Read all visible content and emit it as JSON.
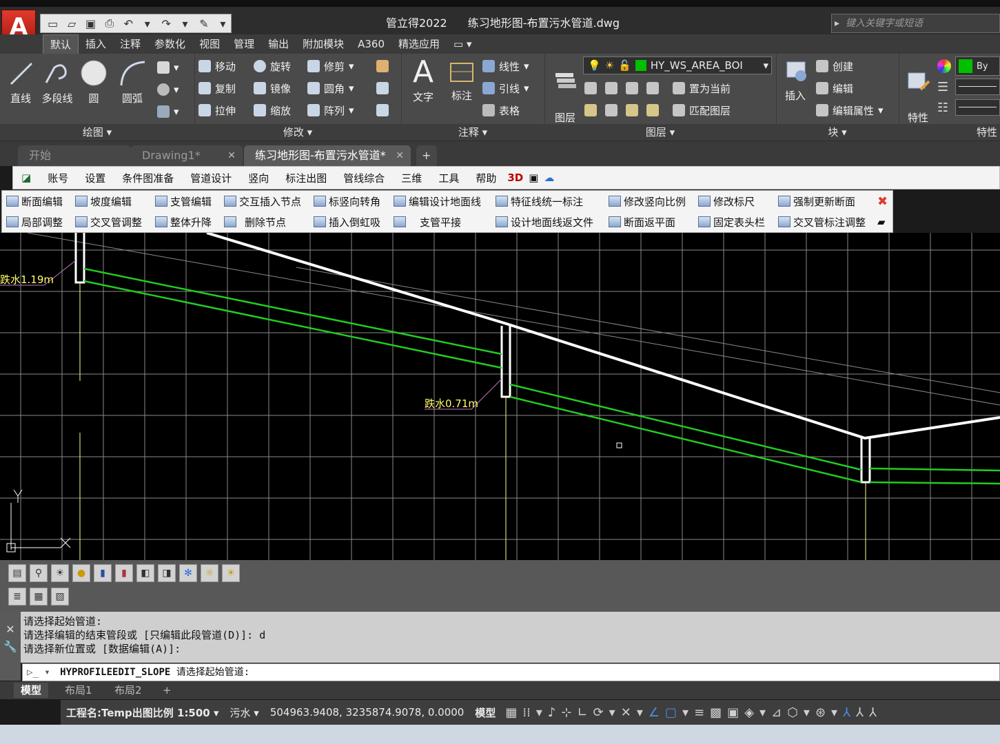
{
  "app": {
    "logo_letter": "A",
    "title_app": "管立得2022",
    "title_file": "练习地形图-布置污水管道.dwg",
    "search_placeholder": "键入关键字或短语"
  },
  "menu_tabs": [
    "默认",
    "插入",
    "注释",
    "参数化",
    "视图",
    "管理",
    "输出",
    "附加模块",
    "A360",
    "精选应用"
  ],
  "ribbon": {
    "draw": {
      "title": "绘图",
      "line": "直线",
      "polyline": "多段线",
      "circle": "圆",
      "arc": "圆弧"
    },
    "modify": {
      "title": "修改",
      "move": "移动",
      "rotate": "旋转",
      "trim": "修剪",
      "copy": "复制",
      "mirror": "镜像",
      "fillet": "圆角",
      "stretch": "拉伸",
      "scale": "缩放",
      "array": "阵列"
    },
    "annotate": {
      "title": "注释",
      "text": "文字",
      "dimension": "标注",
      "linear": "线性",
      "leader": "引线",
      "table": "表格"
    },
    "layers": {
      "title": "图层",
      "layer_props": "图层\n特性",
      "layer_name": "HY_WS_AREA_BOI",
      "set_current": "置为当前",
      "match_layer": "匹配图层",
      "layer_color": "#00c000"
    },
    "block": {
      "title": "块",
      "insert": "插入",
      "create": "创建",
      "edit": "编辑",
      "edit_attr": "编辑属性"
    },
    "properties": {
      "title": "特性",
      "match": "特性\n匹配",
      "bylayer": "By"
    }
  },
  "doc_tabs": [
    {
      "label": "开始",
      "active": false
    },
    {
      "label": "Drawing1*",
      "active": false
    },
    {
      "label": "练习地形图-布置污水管道*",
      "active": true
    }
  ],
  "plugin_menu": [
    "账号",
    "设置",
    "条件图准备",
    "管道设计",
    "竖向",
    "标注出图",
    "管线综合",
    "三维",
    "工具",
    "帮助"
  ],
  "float_toolbar": {
    "row1": [
      "断面编辑",
      "坡度编辑",
      "支管编辑",
      "交互插入节点",
      "标竖向转角",
      "编辑设计地面线",
      "特征线统一标注",
      "修改竖向比例",
      "修改标尺",
      "强制更新断面"
    ],
    "row2": [
      "局部调整",
      "交叉管调整",
      "整体升降",
      "删除节点",
      "插入倒虹吸",
      "支管平接",
      "设计地面线返文件",
      "断面返平面",
      "固定表头栏",
      "交叉管标注调整"
    ]
  },
  "drawing": {
    "label1": "跌水1.19m",
    "label2": "跌水0.71m",
    "ucs_y": "Y",
    "grid_color": "#8a8a8a",
    "ground_color": "#ffffff",
    "pipe_color": "#22cc22",
    "label_color": "#ffff66"
  },
  "command": {
    "history": [
      "请选择起始管道:",
      "请选择编辑的结束管段或 [只编辑此段管道(D)]: d",
      " 请选择新位置或 [数据编辑(A)]:"
    ],
    "current_cmd": "HYPROFILEEDIT_SLOPE",
    "current_prompt": "请选择起始管道:"
  },
  "layout_tabs": [
    {
      "label": "模型",
      "active": true
    },
    {
      "label": "布局1",
      "active": false
    },
    {
      "label": "布局2",
      "active": false
    }
  ],
  "status": {
    "project": "工程名:Temp出图比例 1:500",
    "pipe_type": "污水",
    "coords": "504963.9408, 3235874.9078, 0.0000",
    "space": "模型"
  }
}
